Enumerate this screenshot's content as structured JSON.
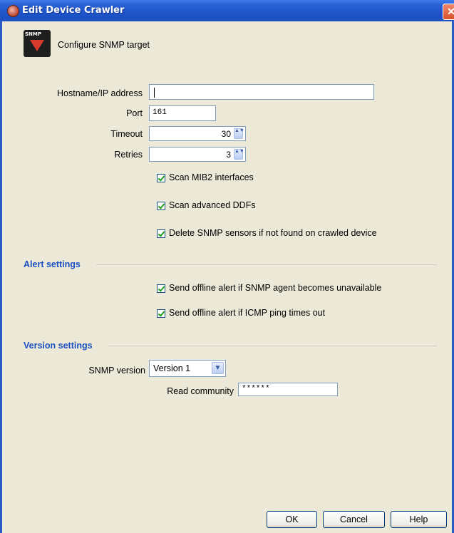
{
  "window": {
    "title": "Edit Device Crawler",
    "close_glyph": "✕"
  },
  "header": {
    "logo_text": "SNMP",
    "text": "Configure SNMP target"
  },
  "form": {
    "hostname_label": "Hostname/IP address",
    "hostname_value": "",
    "port_label": "Port",
    "port_value": "161",
    "timeout_label": "Timeout",
    "timeout_value": "30",
    "retries_label": "Retries",
    "retries_value": "3",
    "scan_mib2_label": "Scan MIB2 interfaces",
    "scan_ddf_label": "Scan advanced DDFs",
    "delete_sensors_label": "Delete SNMP sensors if not found on crawled device"
  },
  "alert": {
    "section_title": "Alert settings",
    "offline_agent_label": "Send offline alert if SNMP agent becomes unavailable",
    "offline_icmp_label": "Send offline alert if ICMP ping times out"
  },
  "version": {
    "section_title": "Version settings",
    "snmp_version_label": "SNMP version",
    "snmp_version_value": "Version 1",
    "read_community_label": "Read community",
    "read_community_value": "******"
  },
  "buttons": {
    "ok": "OK",
    "cancel": "Cancel",
    "help": "Help"
  },
  "icons": {
    "spin": "▲▼",
    "dropdown": "▼"
  },
  "colors": {
    "titlebar": "#1f55c9",
    "section_title": "#1b4fc2",
    "check": "#21a121"
  }
}
